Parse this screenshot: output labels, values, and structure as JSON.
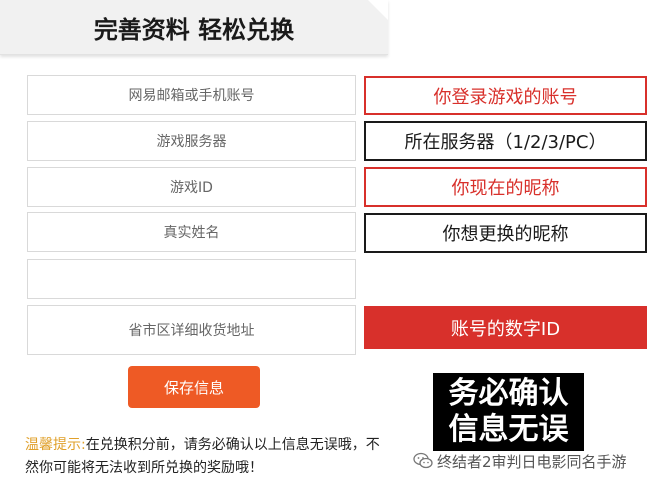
{
  "header": {
    "title": "完善资料 轻松兑换"
  },
  "form": {
    "fields": [
      {
        "placeholder": "网易邮箱或手机账号"
      },
      {
        "placeholder": "游戏服务器"
      },
      {
        "placeholder": "游戏ID"
      },
      {
        "placeholder": "真实姓名"
      },
      {
        "placeholder": ""
      },
      {
        "placeholder": "省市区详细收货地址"
      }
    ],
    "save_label": "保存信息"
  },
  "annotations": {
    "account": "你登录游戏的账号",
    "server": "所在服务器（1/2/3/PC）",
    "current_nick": "你现在的昵称",
    "new_nick": "你想更换的昵称",
    "numeric_id": "账号的数字ID"
  },
  "confirm": {
    "line1": "务必确认",
    "line2": "信息无误"
  },
  "tip": {
    "label": "温馨提示:",
    "text": "在兑换积分前，请务必确认以上信息无误哦，不然你可能将无法收到所兑换的奖励哦！"
  },
  "watermark": {
    "icon": "wechat-icon",
    "text": "终结者2审判日电影同名手游"
  },
  "colors": {
    "accent_red": "#d8302b",
    "button_orange": "#ee5a25",
    "tip_label": "#e0a02a"
  }
}
